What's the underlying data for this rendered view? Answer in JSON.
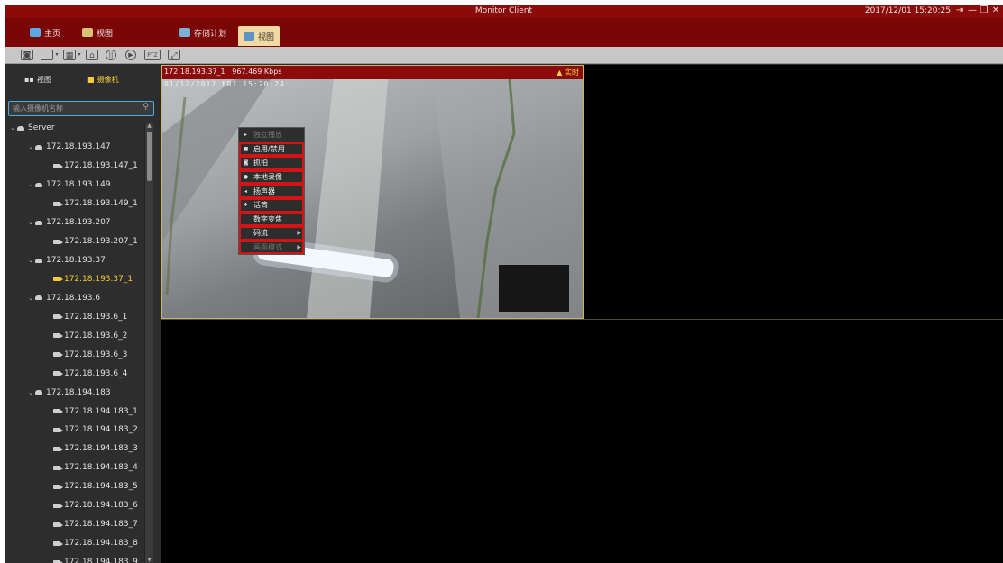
{
  "window": {
    "title": "Monitor Client",
    "clock": "2017/12/01 15:20:25"
  },
  "tabs": [
    {
      "label": "主页",
      "icon": "monitor-icon",
      "active": false
    },
    {
      "label": "视图",
      "icon": "grid-view-icon",
      "active": false
    },
    {
      "label": "存储计划",
      "icon": "storage-plan-icon",
      "active": false
    },
    {
      "label": "视图",
      "icon": "view-icon",
      "active": true
    }
  ],
  "toolbar": {
    "ptz_label": "PTZ"
  },
  "sidebar": {
    "tab_view": "视图",
    "tab_camera": "摄像机",
    "search_placeholder": "输入摄像机名称",
    "tree": [
      {
        "type": "server",
        "label": "Server",
        "level": 0
      },
      {
        "type": "device",
        "label": "172.18.193.147",
        "level": 1
      },
      {
        "type": "camera",
        "label": "172.18.193.147_1",
        "level": 2
      },
      {
        "type": "device",
        "label": "172.18.193.149",
        "level": 1
      },
      {
        "type": "camera",
        "label": "172.18.193.149_1",
        "level": 2
      },
      {
        "type": "device",
        "label": "172.18.193.207",
        "level": 1
      },
      {
        "type": "camera",
        "label": "172.18.193.207_1",
        "level": 2
      },
      {
        "type": "device",
        "label": "172.18.193.37",
        "level": 1
      },
      {
        "type": "camera",
        "label": "172.18.193.37_1",
        "level": 2,
        "selected": true
      },
      {
        "type": "device",
        "label": "172.18.193.6",
        "level": 1
      },
      {
        "type": "camera",
        "label": "172.18.193.6_1",
        "level": 2
      },
      {
        "type": "camera",
        "label": "172.18.193.6_2",
        "level": 2
      },
      {
        "type": "camera",
        "label": "172.18.193.6_3",
        "level": 2
      },
      {
        "type": "camera",
        "label": "172.18.193.6_4",
        "level": 2
      },
      {
        "type": "device",
        "label": "172.18.194.183",
        "level": 1
      },
      {
        "type": "camera",
        "label": "172.18.194.183_1",
        "level": 2
      },
      {
        "type": "camera",
        "label": "172.18.194.183_2",
        "level": 2
      },
      {
        "type": "camera",
        "label": "172.18.194.183_3",
        "level": 2
      },
      {
        "type": "camera",
        "label": "172.18.194.183_4",
        "level": 2
      },
      {
        "type": "camera",
        "label": "172.18.194.183_5",
        "level": 2
      },
      {
        "type": "camera",
        "label": "172.18.194.183_6",
        "level": 2
      },
      {
        "type": "camera",
        "label": "172.18.194.183_7",
        "level": 2
      },
      {
        "type": "camera",
        "label": "172.18.194.183_8",
        "level": 2
      },
      {
        "type": "camera",
        "label": "172.18.194.183_9",
        "level": 2
      }
    ]
  },
  "video": {
    "camera_name": "172.18.193.37_1",
    "bitrate": "967.469 Kbps",
    "status": "实时",
    "osd": "01/12/2017 FRI 15:20:24"
  },
  "context_menu": [
    {
      "label": "独立播放",
      "disabled": true,
      "highlight": false,
      "submenu": false
    },
    {
      "label": "启用/禁用",
      "disabled": false,
      "highlight": true,
      "submenu": false
    },
    {
      "label": "抓拍",
      "disabled": false,
      "highlight": true,
      "submenu": false
    },
    {
      "label": "本地录像",
      "disabled": false,
      "highlight": true,
      "submenu": false
    },
    {
      "label": "扬声器",
      "disabled": false,
      "highlight": true,
      "submenu": false
    },
    {
      "label": "话筒",
      "disabled": false,
      "highlight": true,
      "submenu": false
    },
    {
      "label": "数字变焦",
      "disabled": false,
      "highlight": true,
      "submenu": false
    },
    {
      "label": "码流",
      "disabled": false,
      "highlight": true,
      "submenu": true
    },
    {
      "label": "画面模式",
      "disabled": true,
      "highlight": true,
      "submenu": true
    }
  ],
  "colors": {
    "title_bar": "#8b0a0a",
    "accent": "#f2cb36",
    "active_tab": "#f0d9a2",
    "highlight": "#d11414"
  }
}
